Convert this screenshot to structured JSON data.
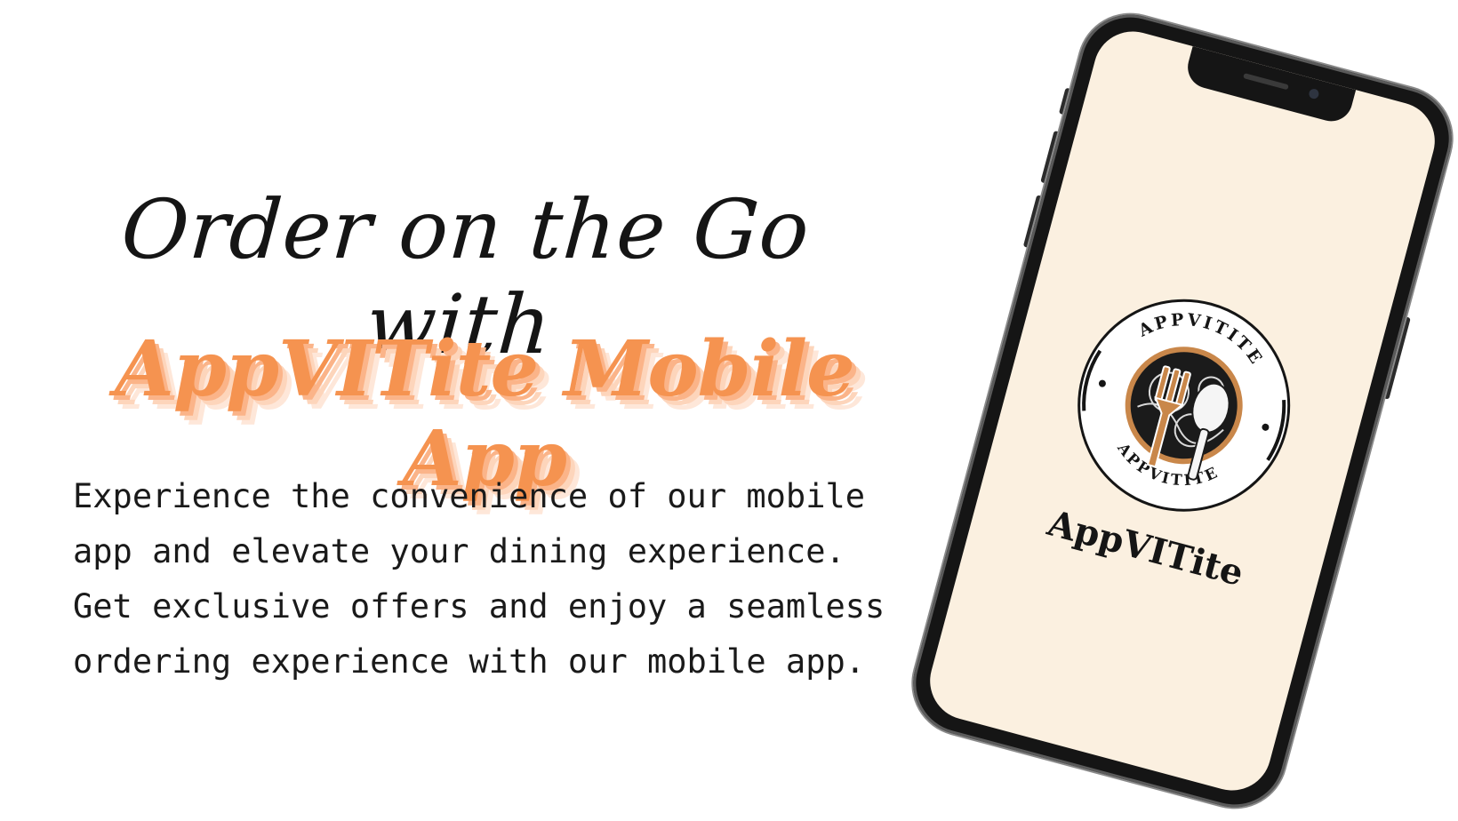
{
  "headline": "Order on the Go with",
  "brand_title": "AppVITite Mobile App",
  "description_lines": [
    "Experience the convenience of our mobile",
    "app and elevate your dining experience.",
    "Get exclusive offers and enjoy a seamless",
    "ordering experience with our mobile app."
  ],
  "phone": {
    "logo_ring_text": "APPVITITE",
    "app_name": "AppVITite"
  },
  "colors": {
    "accent": "#f59350",
    "text": "#151515",
    "screen": "#fbf0e0"
  },
  "icons": [
    "fork-icon",
    "spoon-icon",
    "plate-icon",
    "star-icon"
  ]
}
